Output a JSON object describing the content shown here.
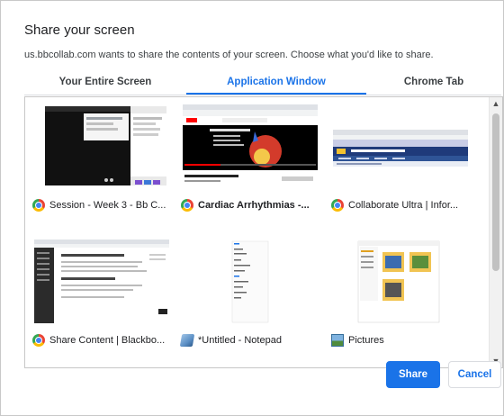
{
  "dialog": {
    "title": "Share your screen",
    "subtitle": "us.bbcollab.com wants to share the contents of your screen. Choose what you'd like to share."
  },
  "tabs": [
    {
      "label": "Your Entire Screen",
      "selected": false
    },
    {
      "label": "Application Window",
      "selected": true
    },
    {
      "label": "Chrome Tab",
      "selected": false
    }
  ],
  "windows": [
    {
      "label": "Session - Week 3 - Bb C...",
      "icon": "chrome-icon",
      "bold": false
    },
    {
      "label": "Cardiac Arrhythmias -...",
      "icon": "chrome-icon",
      "bold": true
    },
    {
      "label": "Collaborate Ultra | Infor...",
      "icon": "chrome-icon",
      "bold": false
    },
    {
      "label": "Share Content | Blackbo...",
      "icon": "chrome-icon",
      "bold": false
    },
    {
      "label": "*Untitled - Notepad",
      "icon": "notepad-icon",
      "bold": false
    },
    {
      "label": "Pictures",
      "icon": "pictures-icon",
      "bold": false
    }
  ],
  "buttons": {
    "share": "Share",
    "cancel": "Cancel"
  },
  "colors": {
    "accent": "#1a73e8",
    "border": "#c7c7c7"
  }
}
